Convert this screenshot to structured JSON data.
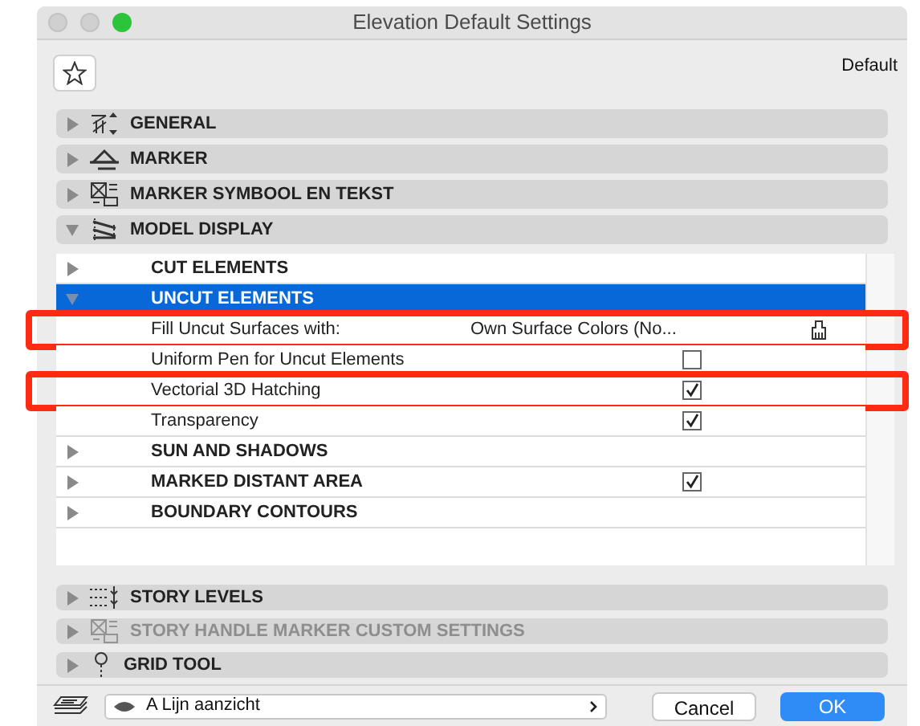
{
  "window": {
    "title": "Elevation Default Settings"
  },
  "toolbar": {
    "preset": "Default"
  },
  "panels_top": [
    {
      "title": "GENERAL",
      "expanded": false,
      "disabled": false
    },
    {
      "title": "MARKER",
      "expanded": false,
      "disabled": false
    },
    {
      "title": "MARKER SYMBOOL EN TEKST",
      "expanded": false,
      "disabled": false
    },
    {
      "title": "MODEL DISPLAY",
      "expanded": true,
      "disabled": false
    }
  ],
  "model_display_rows": [
    {
      "kind": "group",
      "label": "CUT ELEMENTS",
      "expanded": false,
      "selected": false
    },
    {
      "kind": "group",
      "label": "UNCUT ELEMENTS",
      "expanded": true,
      "selected": true
    },
    {
      "kind": "option",
      "label": "Fill Uncut Surfaces with:",
      "value": "Own Surface Colors (No...",
      "highlighted": true
    },
    {
      "kind": "checkbox",
      "label": "Uniform Pen for Uncut Elements",
      "checked": false,
      "highlighted": false
    },
    {
      "kind": "checkbox",
      "label": "Vectorial 3D Hatching",
      "checked": true,
      "highlighted": true
    },
    {
      "kind": "checkbox",
      "label": "Transparency",
      "checked": true,
      "highlighted": false
    },
    {
      "kind": "group",
      "label": "SUN AND SHADOWS",
      "expanded": false,
      "selected": false
    },
    {
      "kind": "group",
      "label": "MARKED DISTANT AREA",
      "expanded": false,
      "selected": false,
      "checked": true
    },
    {
      "kind": "group",
      "label": "BOUNDARY CONTOURS",
      "expanded": false,
      "selected": false
    }
  ],
  "panels_bottom": [
    {
      "title": "STORY LEVELS",
      "expanded": false,
      "disabled": false
    },
    {
      "title": "STORY HANDLE MARKER CUSTOM SETTINGS",
      "expanded": false,
      "disabled": true
    },
    {
      "title": "GRID TOOL",
      "expanded": false,
      "disabled": false
    }
  ],
  "footer": {
    "view": "A Lijn aanzicht",
    "buttons": [
      {
        "label": "Cancel",
        "primary": false
      },
      {
        "label": "OK",
        "primary": true
      }
    ]
  }
}
